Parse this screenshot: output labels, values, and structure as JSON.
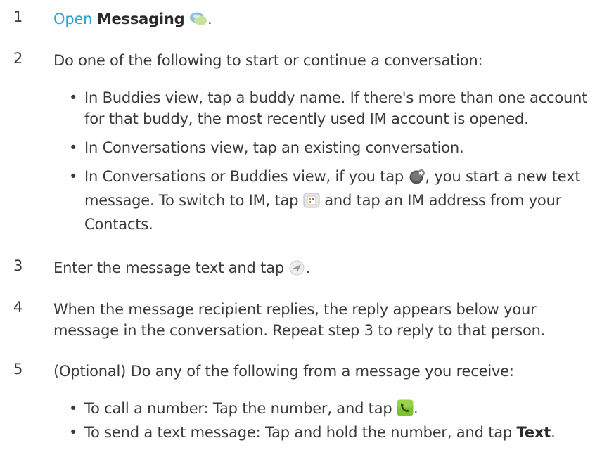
{
  "steps": {
    "s1": {
      "num": "1",
      "open": "Open",
      "app": "Messaging",
      "end": "."
    },
    "s2": {
      "num": "2",
      "text": "Do one of the following to start or continue a conversation:"
    },
    "s2_bullets": {
      "b1_line1": "In Buddies view, tap a buddy name. If there's more than one account",
      "b1_line2": "for that buddy, the most recently used IM account is opened.",
      "b2": "In Conversations view, tap an existing conversation.",
      "b3_a": "In Conversations or Buddies view, if you tap",
      "b3_b": ", you start a new text",
      "b3_c": "message. To switch to IM, tap",
      "b3_d": "and tap an IM address from your",
      "b3_e": "Contacts."
    },
    "s3": {
      "num": "3",
      "text": "Enter the message text and tap",
      "end": "."
    },
    "s4": {
      "num": "4",
      "line1": "When the message recipient replies, the reply appears below your",
      "line2": "message in the conversation. Repeat step 3 to reply to that person."
    },
    "s5": {
      "num": "5",
      "text": "(Optional) Do any of the following from a message you receive:"
    },
    "s5_bullets": {
      "b1": "To call a number: Tap the number, and tap",
      "b1_end": ".",
      "b2": "To send a text message: Tap and hold the number, and tap",
      "b2_bold": "Text",
      "b2_end": "."
    }
  },
  "icons": {
    "messaging": "messaging-app-icon",
    "new_message": "new-message-plus-icon",
    "contacts": "contacts-icon",
    "send": "send-icon",
    "phone": "phone-call-icon"
  }
}
